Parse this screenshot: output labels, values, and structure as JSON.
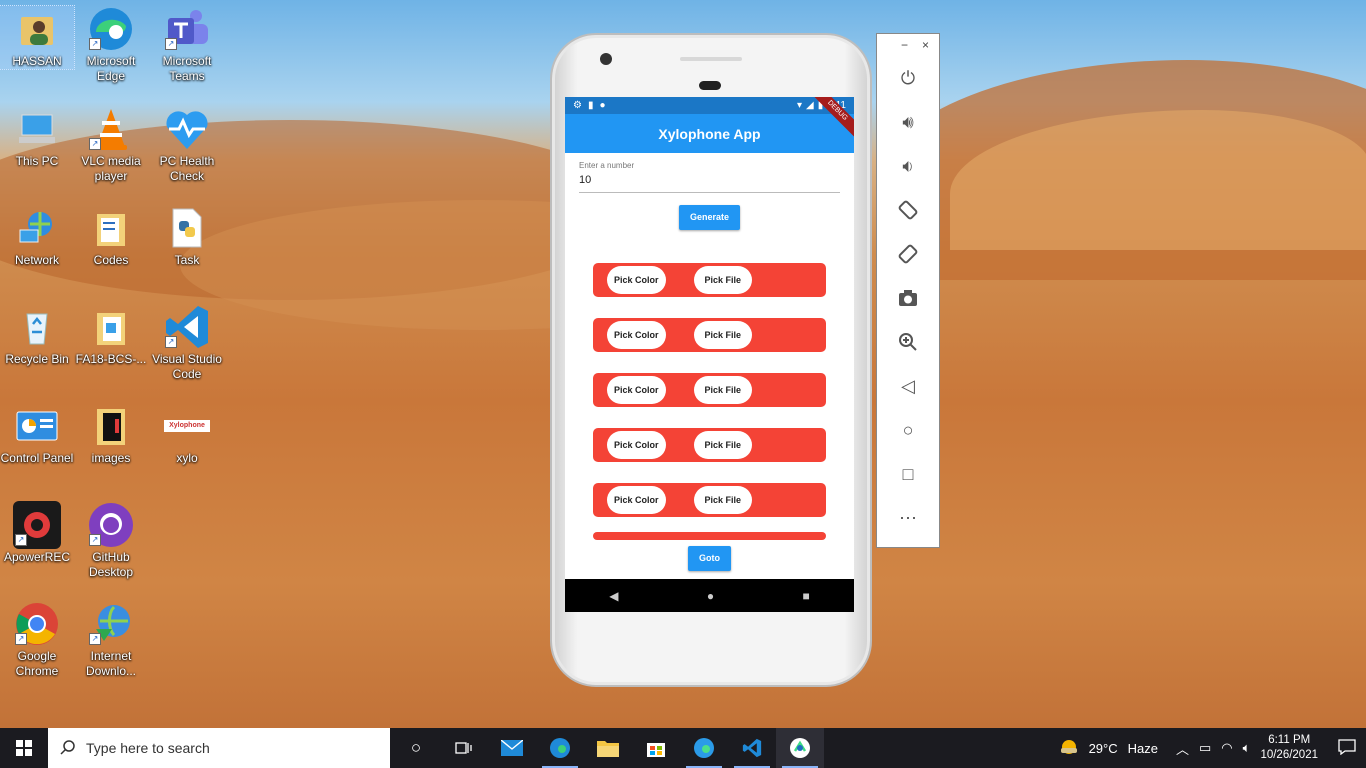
{
  "desktop": {
    "icons": [
      {
        "label": "HASSAN",
        "icon": "user-folder-icon"
      },
      {
        "label": "Microsoft Edge",
        "icon": "edge-icon"
      },
      {
        "label": "Microsoft Teams",
        "icon": "teams-icon"
      },
      {
        "label": "This PC",
        "icon": "computer-icon"
      },
      {
        "label": "VLC media player",
        "icon": "vlc-icon"
      },
      {
        "label": "PC Health Check",
        "icon": "health-check-icon"
      },
      {
        "label": "Network",
        "icon": "network-icon"
      },
      {
        "label": "Codes",
        "icon": "folder-icon"
      },
      {
        "label": "Task",
        "icon": "python-file-icon"
      },
      {
        "label": "Recycle Bin",
        "icon": "recycle-bin-icon"
      },
      {
        "label": "FA18-BCS-...",
        "icon": "folder-icon"
      },
      {
        "label": "Visual Studio Code",
        "icon": "vscode-icon"
      },
      {
        "label": "Control Panel",
        "icon": "control-panel-icon"
      },
      {
        "label": "images",
        "icon": "folder-icon"
      },
      {
        "label": "xylo",
        "icon": "image-file-icon"
      },
      {
        "label": "ApowerREC",
        "icon": "apowerrec-icon"
      },
      {
        "label": "GitHub Desktop",
        "icon": "github-icon"
      },
      {
        "label": "Google Chrome",
        "icon": "chrome-icon"
      },
      {
        "label": "Internet Downlo...",
        "icon": "idm-icon"
      }
    ],
    "xylo_thumb_text": "Xylophone"
  },
  "phone": {
    "status_time": "6:11",
    "debug_banner": "DEBUG",
    "app_title": "Xylophone App",
    "input_label": "Enter a number",
    "input_value": "10",
    "generate_label": "Generate",
    "rows": [
      {
        "pick_color": "Pick Color",
        "pick_file": "Pick File"
      },
      {
        "pick_color": "Pick Color",
        "pick_file": "Pick File"
      },
      {
        "pick_color": "Pick Color",
        "pick_file": "Pick File"
      },
      {
        "pick_color": "Pick Color",
        "pick_file": "Pick File"
      },
      {
        "pick_color": "Pick Color",
        "pick_file": "Pick File"
      }
    ],
    "goto_label": "Goto",
    "colors": {
      "appbar": "#2196f3",
      "row": "#f44336",
      "statusbar": "#1b77c6"
    }
  },
  "emulator_toolbar": {
    "minimize": "−",
    "close": "×",
    "tools": [
      "power-icon",
      "volume-up-icon",
      "volume-down-icon",
      "rotate-left-icon",
      "rotate-right-icon",
      "screenshot-icon",
      "zoom-icon",
      "back-icon",
      "home-icon",
      "overview-icon",
      "more-icon"
    ]
  },
  "taskbar": {
    "search_placeholder": "Type here to search",
    "weather_temp": "29°C",
    "weather_desc": "Haze",
    "time": "6:11 PM",
    "date": "10/26/2021"
  }
}
